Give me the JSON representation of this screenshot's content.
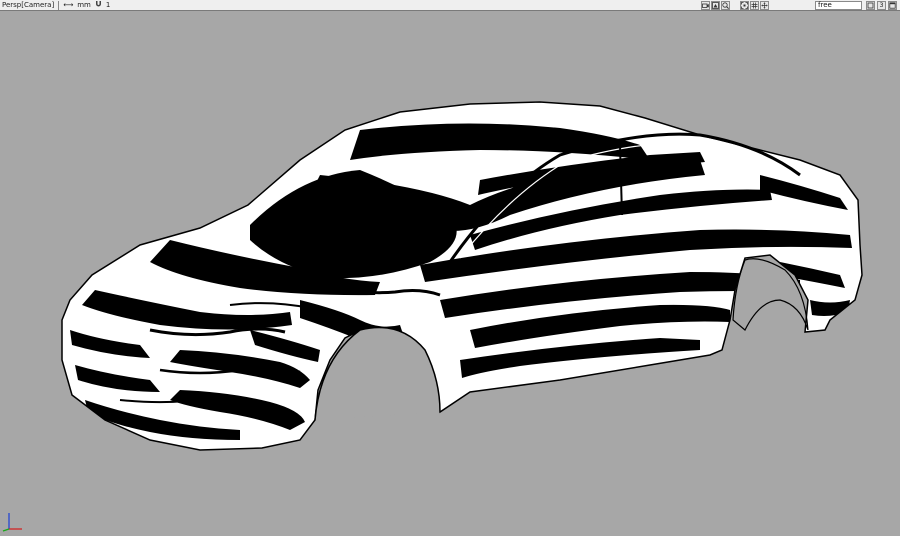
{
  "viewport": {
    "title": "Persp[Camera]",
    "units_symbol": "⟷",
    "units": "mm",
    "snap_icon": "magnet-icon",
    "snap_value": "1",
    "mode": "free",
    "layout_number": "3",
    "background_color": "#a7a7a7"
  },
  "toolbar": {
    "icons": [
      "camera-icon",
      "render-icon",
      "zoom-icon",
      "fit-view-icon",
      "grid-icon",
      "move-view-icon",
      "toggle-icon",
      "layout-icon",
      "maximize-icon"
    ]
  },
  "scene": {
    "object": "car body",
    "shading": "zebra stripe reflection"
  },
  "axis_triad": {
    "x_color": "#d61a1a",
    "y_color": "#19a719",
    "z_color": "#1b3fd6"
  }
}
